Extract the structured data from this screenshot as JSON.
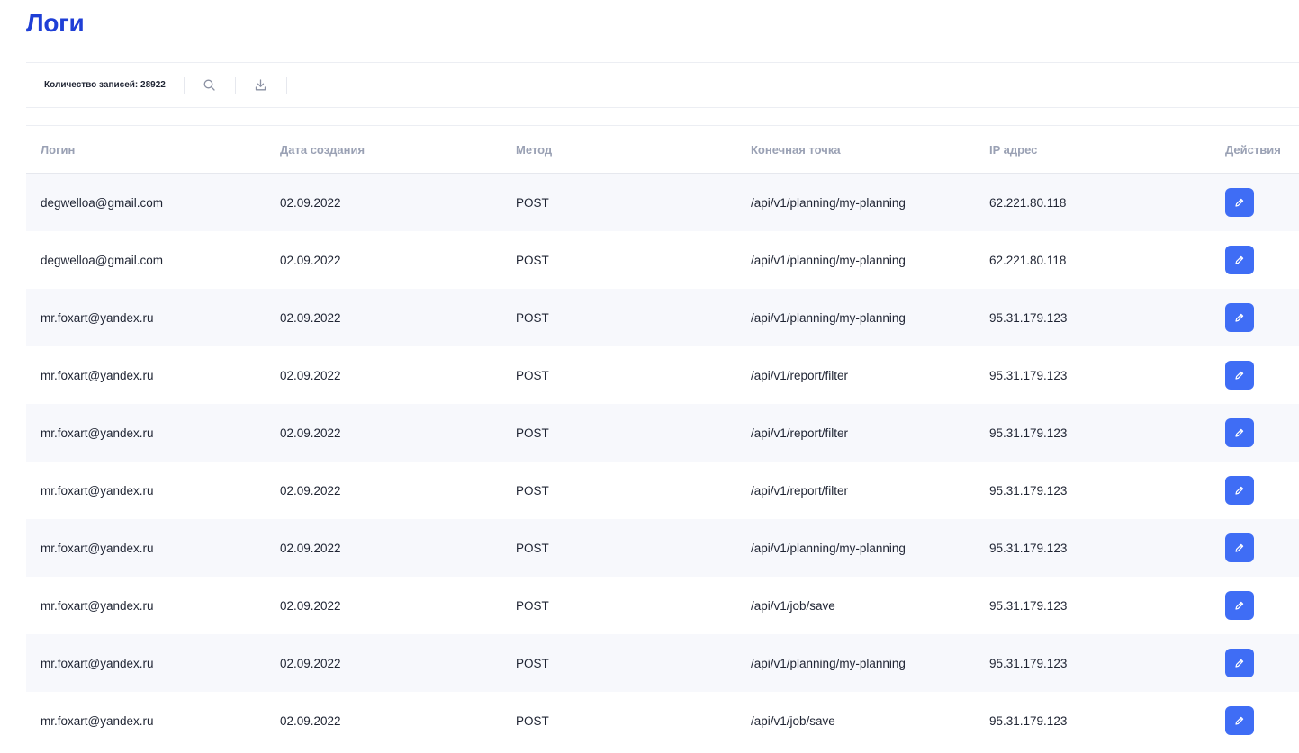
{
  "page": {
    "title": "Логи"
  },
  "toolbar": {
    "records_label": "Количество записей: 28922",
    "search_icon": "search-icon",
    "download_icon": "download-icon"
  },
  "table": {
    "headers": [
      "Логин",
      "Дата создания",
      "Метод",
      "Конечная точка",
      "IP адрес",
      "Действия"
    ],
    "rows": [
      {
        "login": "degwelloa@gmail.com",
        "date": "02.09.2022",
        "method": "POST",
        "endpoint": "/api/v1/planning/my-planning",
        "ip": "62.221.80.118"
      },
      {
        "login": "degwelloa@gmail.com",
        "date": "02.09.2022",
        "method": "POST",
        "endpoint": "/api/v1/planning/my-planning",
        "ip": "62.221.80.118"
      },
      {
        "login": "mr.foxart@yandex.ru",
        "date": "02.09.2022",
        "method": "POST",
        "endpoint": "/api/v1/planning/my-planning",
        "ip": "95.31.179.123"
      },
      {
        "login": "mr.foxart@yandex.ru",
        "date": "02.09.2022",
        "method": "POST",
        "endpoint": "/api/v1/report/filter",
        "ip": "95.31.179.123"
      },
      {
        "login": "mr.foxart@yandex.ru",
        "date": "02.09.2022",
        "method": "POST",
        "endpoint": "/api/v1/report/filter",
        "ip": "95.31.179.123"
      },
      {
        "login": "mr.foxart@yandex.ru",
        "date": "02.09.2022",
        "method": "POST",
        "endpoint": "/api/v1/report/filter",
        "ip": "95.31.179.123"
      },
      {
        "login": "mr.foxart@yandex.ru",
        "date": "02.09.2022",
        "method": "POST",
        "endpoint": "/api/v1/planning/my-planning",
        "ip": "95.31.179.123"
      },
      {
        "login": "mr.foxart@yandex.ru",
        "date": "02.09.2022",
        "method": "POST",
        "endpoint": "/api/v1/job/save",
        "ip": "95.31.179.123"
      },
      {
        "login": "mr.foxart@yandex.ru",
        "date": "02.09.2022",
        "method": "POST",
        "endpoint": "/api/v1/planning/my-planning",
        "ip": "95.31.179.123"
      },
      {
        "login": "mr.foxart@yandex.ru",
        "date": "02.09.2022",
        "method": "POST",
        "endpoint": "/api/v1/job/save",
        "ip": "95.31.179.123"
      }
    ],
    "action_icon": "pencil-icon"
  },
  "colors": {
    "title": "#1f3fd6",
    "accent_button": "#3f6df5",
    "header_text": "#9aa1b4",
    "alt_row": "#f7f8fc"
  }
}
